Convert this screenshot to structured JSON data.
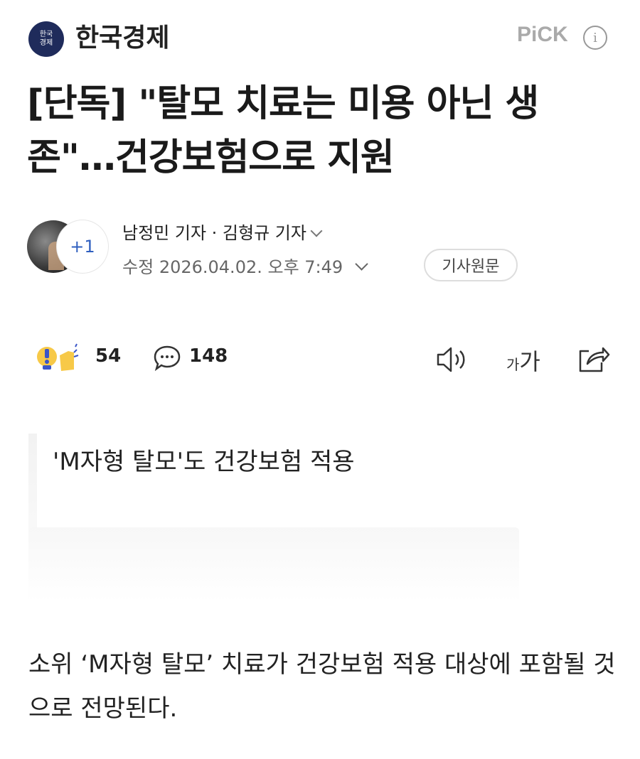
{
  "header": {
    "press_logo_text_1": "한국",
    "press_logo_text_2": "경제",
    "press_name": "한국경제",
    "pick_label": "PiCK",
    "info_icon": "i"
  },
  "article": {
    "title": "[단독] \"탈모 치료는 미용 아닌 생존\"…건강보험으로 지원",
    "reporters": "남정민 기자 · 김형규 기자",
    "extra_reporters": "+1",
    "modified_label": "수정",
    "modified_datetime": "2026.04.02. 오후 7:49",
    "original_button": "기사원문",
    "subheading": "'M자형 탈모'도 건강보험 적용",
    "body": "소위 ‘M자형 탈모’ 치료가 건강보험 적용 대상에 포함될 것으로 전망된다."
  },
  "actions": {
    "reaction_count": "54",
    "comment_count": "148",
    "font_small": "가",
    "font_big": "가",
    "icons": [
      "reaction-icon",
      "comment-icon",
      "speaker-icon",
      "font-size-icon",
      "share-icon"
    ]
  },
  "colors": {
    "logo_bg": "#1f2b5b",
    "extra_accent": "#2f5fbf"
  }
}
